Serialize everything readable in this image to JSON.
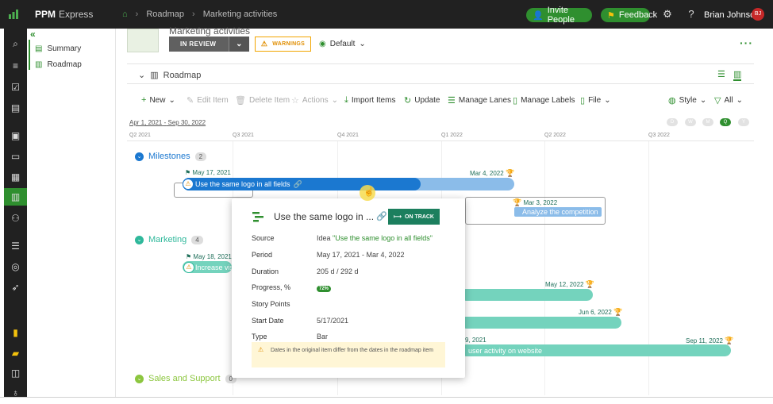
{
  "topbar": {
    "brand": "PPM",
    "brand_sub": "Express",
    "breadcrumbs": [
      "Roadmap",
      "Marketing activities"
    ],
    "invite_label": "Invite People",
    "feedback_label": "Feedback",
    "help": "?",
    "user_name": "Brian Johnson",
    "user_initials": "BJ"
  },
  "subnav": {
    "collapse": "«",
    "items": [
      {
        "label": "Summary"
      },
      {
        "label": "Roadmap"
      }
    ]
  },
  "header": {
    "title": "Marketing activities",
    "status": "IN REVIEW",
    "warnings_label": "WARNINGS",
    "view_label": "Default",
    "more": "···"
  },
  "section": {
    "label": "Roadmap"
  },
  "toolbar": {
    "new": "New",
    "edit_item": "Edit Item",
    "delete_item": "Delete Item",
    "actions": "Actions",
    "import_items": "Import Items",
    "update": "Update",
    "manage_lanes": "Manage Lanes",
    "manage_labels": "Manage Labels",
    "file": "File",
    "style": "Style",
    "filter": "All"
  },
  "timeline": {
    "date_start": "Apr 1, 2021",
    "date_sep": "-",
    "date_end": "Sep 30, 2022",
    "scales": [
      "D",
      "W",
      "M",
      "Q",
      "Y"
    ],
    "selected_scale": "Q",
    "quarters": [
      "Q2 2021",
      "Q3 2021",
      "Q4 2021",
      "Q1 2022",
      "Q2 2022",
      "Q3 2022"
    ]
  },
  "lanes": {
    "milestones": {
      "name": "Milestones",
      "count": "2",
      "color": "#1b78d0"
    },
    "marketing": {
      "name": "Marketing",
      "count": "4",
      "color": "#2fb89b"
    },
    "sales": {
      "name": "Sales and Support",
      "count": "0",
      "color": "#8cc63f"
    }
  },
  "bars": {
    "main": {
      "start_label": "May 17, 2021",
      "end_label": "Mar 4, 2022",
      "title": "Use the same logo in all fields"
    },
    "competition": {
      "date": "Mar 3, 2022",
      "title": "Analyze the competition"
    },
    "mk1": {
      "start_label": "May 18, 2021",
      "title": "Increase vis"
    },
    "mk2": {
      "end_label": "May 12, 2022"
    },
    "mk3": {
      "end_label": "Jun 6, 2022"
    },
    "mk4": {
      "start_label": "9, 2021",
      "end_label": "Sep 11, 2022",
      "title": "user activity on website"
    }
  },
  "popup": {
    "title": "Use the same logo in ...",
    "track": "ON TRACK",
    "rows": {
      "source_label": "Source",
      "source_prefix": "Idea",
      "source_value": "\"Use the same logo in all fields\"",
      "period_label": "Period",
      "period_value": "May 17, 2021 - Mar 4, 2022",
      "duration_label": "Duration",
      "duration_value": "205 d / 292 d",
      "progress_label": "Progress, %",
      "progress_value": "72%",
      "story_label": "Story Points",
      "start_label": "Start Date",
      "start_value": "5/17/2021",
      "type_label": "Type",
      "type_value": "Bar"
    },
    "note": "Dates in the original item differ from the dates in the roadmap item"
  },
  "colors": {
    "brand_green": "#2f8f2f",
    "dark_nav": "#212121",
    "bar_blue": "#1b78d0",
    "bar_teal": "#74d3bd",
    "warning": "#f2a500"
  }
}
